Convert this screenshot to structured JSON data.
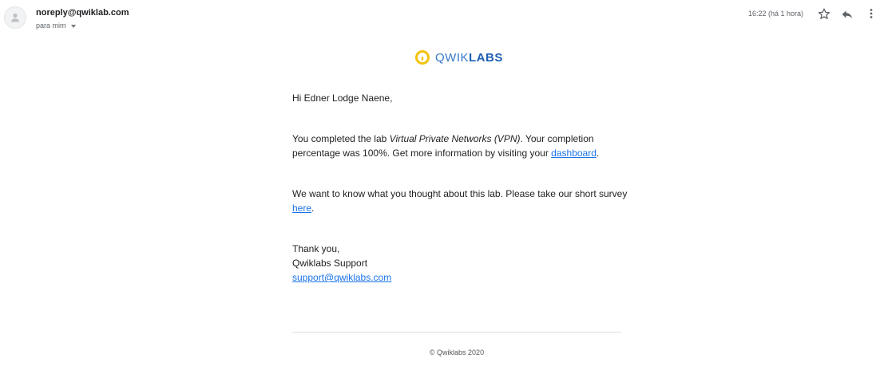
{
  "header": {
    "sender": "noreply@qwiklab.com",
    "recipient_line": "para mim",
    "timestamp": "16:22 (há 1 hora)",
    "icons": [
      "person-icon",
      "star-icon",
      "reply-icon",
      "more-vert-icon"
    ]
  },
  "logo": {
    "prefix": "QWIK",
    "suffix": "LABS",
    "colors": {
      "ring": "#f4c20d",
      "text": "#3779c8"
    }
  },
  "body": {
    "greeting": "Hi Edner Lodge Naene,",
    "p1_start": "You completed the lab ",
    "p1_lab_name": "Virtual Private Networks (VPN)",
    "p1_middle": ". Your completion percentage was 100%. Get more information by visiting your ",
    "p1_link": "dashboard",
    "p1_end": ".",
    "p2_start": "We want to know what you thought about this lab. Please take our short survey ",
    "p2_link": "here",
    "p2_end": ".",
    "signoff": "Thank you,",
    "signature": "Qwiklabs Support",
    "support_email": "support@qwiklabs.com"
  },
  "footer": {
    "copyright": "© Qwiklabs 2020"
  },
  "colors": {
    "link": "#1a73e8",
    "text": "#222222",
    "muted": "#5f6368"
  }
}
